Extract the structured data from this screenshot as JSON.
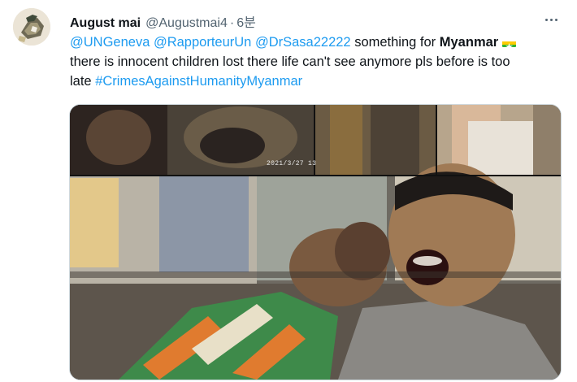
{
  "tweet": {
    "author_name": "August mai",
    "author_handle": "@Augustmai4",
    "separator": "·",
    "timestamp": "6분",
    "more_icon": "more-horizontal-icon",
    "text": {
      "mention_1": "@UNGeneva",
      "mention_2": "@RapporteurUn",
      "mention_3": "@DrSasa22222",
      "segment_1": "something for",
      "bold_word": "Myanmar",
      "flag_icon": "myanmar-flag-icon",
      "line_2": "there is innocent children lost there life can't see anymore pls before is too",
      "line_3_prefix": "late",
      "hashtag": "#CrimesAgainstHumanityMyanmar"
    },
    "media": {
      "photo_timestamp": "2021/3/27  13"
    }
  },
  "colors": {
    "link": "#1d9bf0",
    "text": "#0f1419",
    "secondary": "#536471",
    "border": "#cfd9de"
  }
}
